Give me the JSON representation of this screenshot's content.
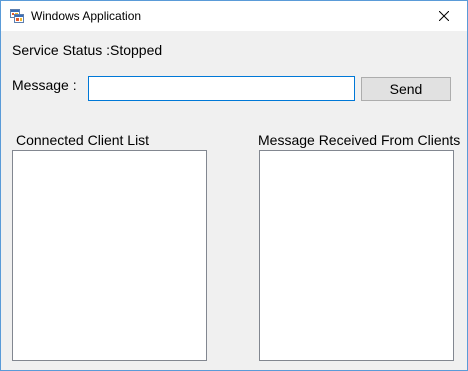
{
  "window": {
    "title": "Windows Application",
    "icon": "windows-form-app-icon",
    "close_icon": "close-icon"
  },
  "status": {
    "label": "Service Status :",
    "value": "Stopped"
  },
  "message": {
    "label": "Message :",
    "value": "",
    "placeholder": ""
  },
  "send_button": {
    "label": "Send"
  },
  "clients": {
    "label": "Connected Client List",
    "items": []
  },
  "received": {
    "label": "Message Received From Clients",
    "items": []
  },
  "colors": {
    "window_border": "#5a9bd8",
    "focus_border": "#0078d7",
    "form_background": "#f0f0f0",
    "button_background": "#e1e1e1"
  }
}
